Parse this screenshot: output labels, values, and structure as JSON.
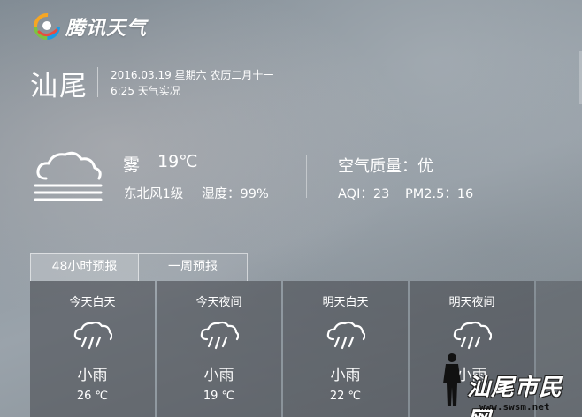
{
  "brand": {
    "name": "腾讯天气",
    "colors": [
      "#1a9be6",
      "#7cc242",
      "#f6a623",
      "#e94c3d"
    ]
  },
  "location": {
    "city": "汕尾",
    "date": "2016.03.19 星期六 农历二月十一",
    "update": "6:25 天气实况"
  },
  "current": {
    "icon": "fog-cloud-icon",
    "condition": "雾",
    "temperature": "19℃",
    "wind": "东北风1级",
    "humidity": "湿度：99%"
  },
  "air_quality": {
    "title": "空气质量：优",
    "aqi": "AQI：23",
    "pm25": "PM2.5：16"
  },
  "tabs": [
    {
      "label": "48小时预报",
      "active": true
    },
    {
      "label": "一周预报",
      "active": false
    }
  ],
  "forecast": [
    {
      "period": "今天白天",
      "icon": "rain-cloud-icon",
      "condition": "小雨",
      "temp": "26 ℃"
    },
    {
      "period": "今天夜间",
      "icon": "rain-cloud-icon",
      "condition": "小雨",
      "temp": "19 ℃"
    },
    {
      "period": "明天白天",
      "icon": "rain-cloud-icon",
      "condition": "小雨",
      "temp": "22 ℃"
    },
    {
      "period": "明天夜间",
      "icon": "rain-cloud-icon",
      "condition": "小雨",
      "temp": ""
    }
  ],
  "watermark": {
    "text": "汕尾市民网",
    "url": "www.swsm.net"
  }
}
